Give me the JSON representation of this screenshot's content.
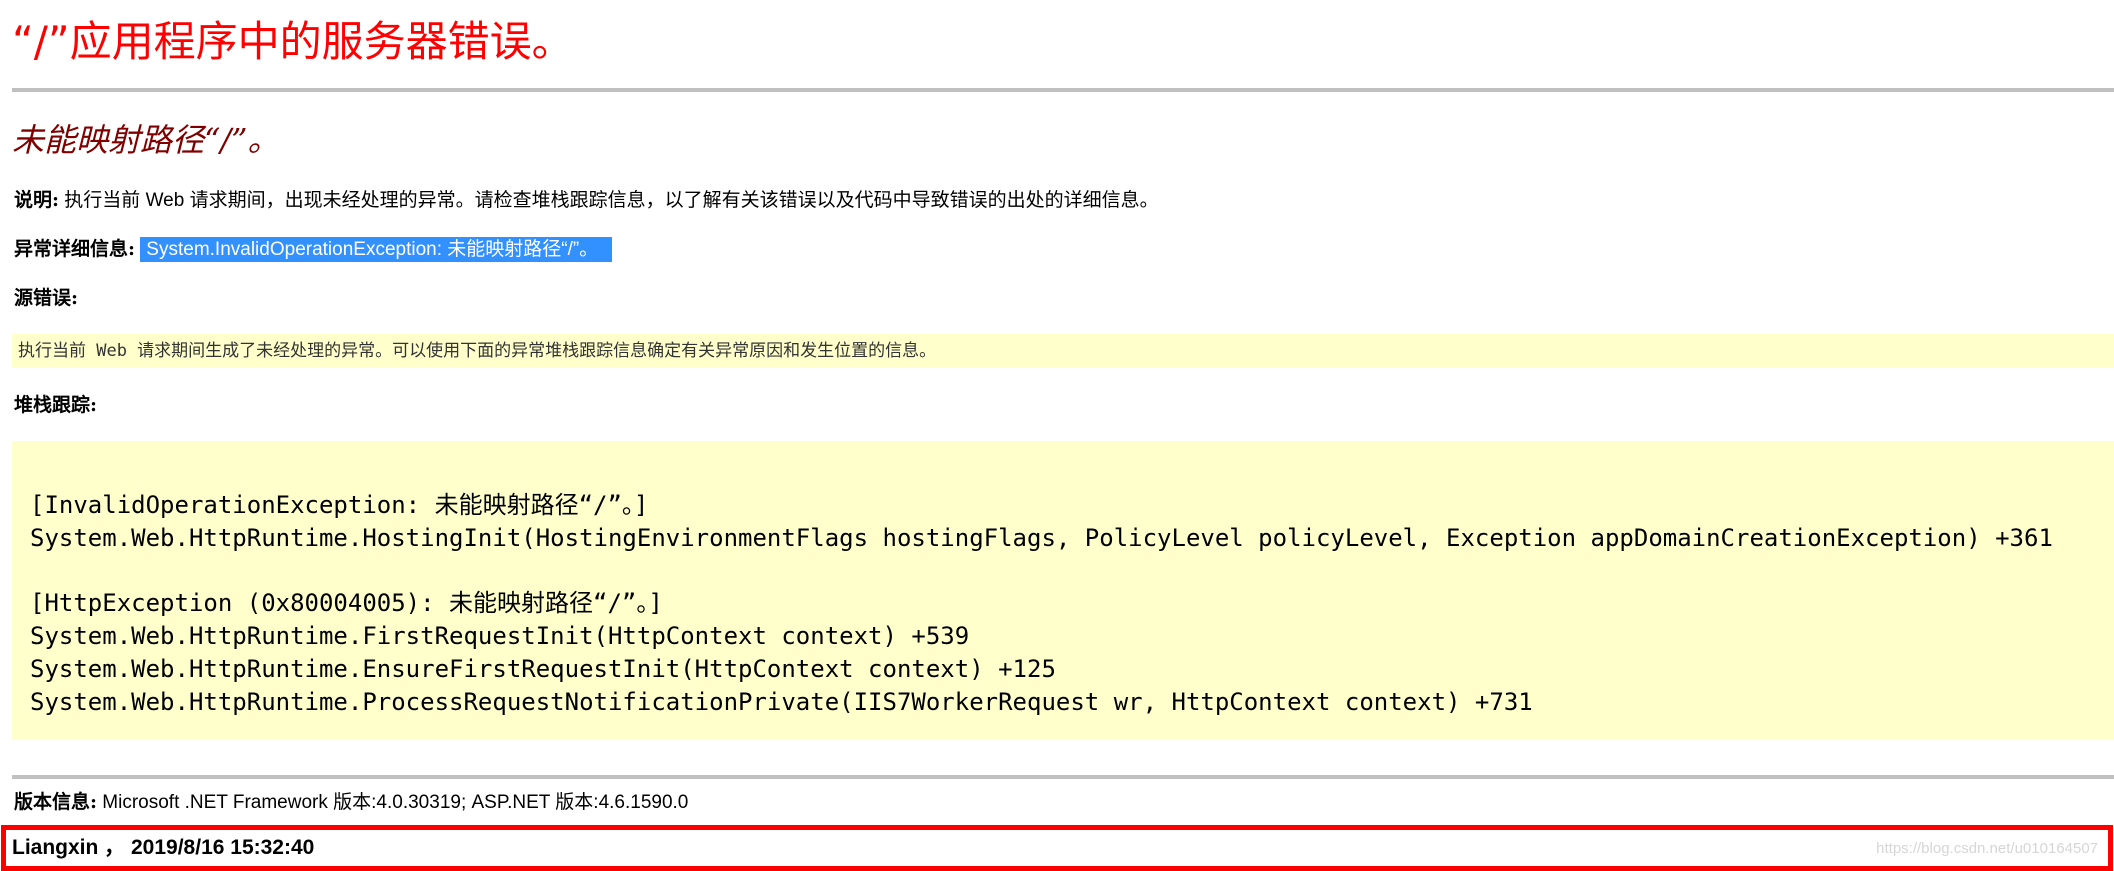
{
  "title": "“/”应用程序中的服务器错误。",
  "error_heading": "未能映射路径“/”。",
  "description": {
    "label": "说明:",
    "text": " 执行当前 Web 请求期间，出现未经处理的异常。请检查堆栈跟踪信息，以了解有关该错误以及代码中导致错误的出处的详细信息。"
  },
  "exception_details": {
    "label": "异常详细信息:",
    "text": "System.InvalidOperationException: 未能映射路径“/”。"
  },
  "source_error": {
    "label": "源错误:",
    "text": "执行当前 Web 请求期间生成了未经处理的异常。可以使用下面的异常堆栈跟踪信息确定有关异常原因和发生位置的信息。"
  },
  "stack_trace": {
    "label": "堆栈跟踪:",
    "lines": [
      "[InvalidOperationException: 未能映射路径“/”。]",
      "   System.Web.HttpRuntime.HostingInit(HostingEnvironmentFlags hostingFlags, PolicyLevel policyLevel, Exception appDomainCreationException) +361",
      "[HttpException (0x80004005): 未能映射路径“/”。]",
      "   System.Web.HttpRuntime.FirstRequestInit(HttpContext context) +539",
      "   System.Web.HttpRuntime.EnsureFirstRequestInit(HttpContext context) +125",
      "   System.Web.HttpRuntime.ProcessRequestNotificationPrivate(IIS7WorkerRequest wr, HttpContext context) +731"
    ]
  },
  "version_info": {
    "label": "版本信息:",
    "text": " Microsoft .NET Framework 版本:4.0.30319; ASP.NET 版本:4.6.1590.0"
  },
  "footer": {
    "text": "Liangxin ， 2019/8/16 15:32:40",
    "watermark": "https://blog.csdn.net/u010164507"
  },
  "colors": {
    "title": "#ff0000",
    "heading": "#800000",
    "code_background": "#ffffcc",
    "selection": "#3390ff",
    "footer_border": "#ff0000"
  }
}
